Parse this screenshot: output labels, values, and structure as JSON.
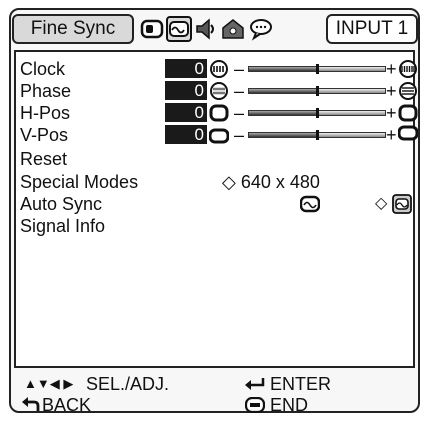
{
  "menu": {
    "title": "Fine Sync",
    "input_label": "INPUT 1",
    "tab_icons": [
      "picture-tab-icon",
      "fine-sync-tab-icon",
      "audio-tab-icon",
      "options-tab-icon",
      "language-tab-icon"
    ]
  },
  "items": [
    {
      "label": "Clock",
      "value": "0",
      "minus": "–",
      "plus": "+",
      "level": 0.5
    },
    {
      "label": "Phase",
      "value": "0",
      "minus": "–",
      "plus": "+",
      "level": 0.5
    },
    {
      "label": "H-Pos",
      "value": "0",
      "minus": "–",
      "plus": "+",
      "level": 0.5
    },
    {
      "label": "V-Pos",
      "value": "0",
      "minus": "–",
      "plus": "+",
      "level": 0.5
    }
  ],
  "reset_label": "Reset",
  "special_modes": {
    "label": "Special Modes",
    "value": "640 x 480",
    "arrow": "◇"
  },
  "auto_sync": {
    "label": "Auto Sync",
    "arrow": "◇"
  },
  "signal_info_label": "Signal Info",
  "footer": {
    "nav_arrows": "▲▼◀ ▶",
    "sel_adj": "SEL./ADJ.",
    "enter": "ENTER",
    "back": "BACK",
    "end": "END"
  }
}
